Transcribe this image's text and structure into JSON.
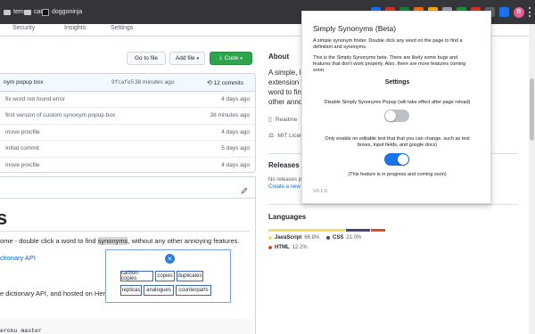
{
  "browser": {
    "bookmarks": [
      {
        "label": "temp",
        "icon": "folder-icon"
      },
      {
        "label": "car",
        "icon": "folder-icon"
      },
      {
        "label": "doggoninja",
        "icon": "black-square-icon"
      }
    ],
    "profile_initial": "B",
    "extension_colors": [
      "#1a73e8",
      "#d93025",
      "#188038",
      "#e8710a",
      "#f9ab00",
      "#9aa0a6",
      "#1e8e3e",
      "#d93025",
      "#5f6368",
      "#1a73e8"
    ]
  },
  "repo_nav": {
    "items": [
      "Security",
      "Insights",
      "Settings"
    ]
  },
  "toolbar": {
    "go_to_file": "Go to file",
    "add_file": "Add file",
    "code": "Code"
  },
  "commit": {
    "message": "nym popup box",
    "hash": "9fcafe5",
    "time": "38 minutes ago",
    "count": "12 commits"
  },
  "files": [
    {
      "message": "fix word not found error",
      "age": "4 days ago"
    },
    {
      "message": "first version of custom synonym popup box",
      "age": "38 minutes ago"
    },
    {
      "message": "move procfile",
      "age": "4 days ago"
    },
    {
      "message": "Initial commit",
      "age": "5 days ago"
    },
    {
      "message": "move procfile",
      "age": "4 days ago"
    }
  ],
  "readme": {
    "heading": "s",
    "para_before": "ome - double click a word to find ",
    "para_highlight": "synonyms",
    "para_after": ", without any other annoying features.",
    "link": "ctionary API",
    "para2_before": "e dictionary API, and hosted on Her",
    "code": "eroku master"
  },
  "synonym_popup": {
    "close_symbol": "×",
    "words": [
      "carbon-copies",
      "copies",
      "duplicates",
      "replicas",
      "analogues",
      "counterparts"
    ]
  },
  "about": {
    "title": "About",
    "description_lines": [
      "A simple, li",
      "extension f",
      "word to find",
      "other annoy"
    ],
    "readme_label": "Readme",
    "license_label": "MIT Licen"
  },
  "releases": {
    "title": "Releases",
    "line1": "No releases pu",
    "line2": "Create a new re"
  },
  "languages": {
    "title": "Languages",
    "items": [
      {
        "name": "JavaScript",
        "percent": "66.8%",
        "value": 66.8,
        "color": "#f1e05a"
      },
      {
        "name": "CSS",
        "percent": "21.0%",
        "value": 21.0,
        "color": "#563d7c"
      },
      {
        "name": "HTML",
        "percent": "12.2%",
        "value": 12.2,
        "color": "#e34c26"
      }
    ]
  },
  "extension_popup": {
    "title": "Simply Synonyms (Beta)",
    "intro_line1": "A simple synonym finder. Double click any word on the page to find a",
    "intro_line2": "definition and synonyms.",
    "beta_line1": "This is the Simply Synonyms beta. There are likely some bugs and",
    "beta_line2": "features that don't work properly. Also, there are more features coming",
    "beta_line3": "soon.",
    "settings_title": "Settings",
    "disable_label": "Disable Simply Synonyms Popup (will take effect after page reload)",
    "disable_toggle_on": false,
    "editable_line1": "Only enable on editable text that that you can change, such as text",
    "editable_line2": "boxes, input fields, and google docs)",
    "editable_toggle_on": true,
    "progress_note": "(This feature is in progress and coming soon)",
    "version": "V0.1.0",
    "accent_color": "#1a73e8"
  }
}
